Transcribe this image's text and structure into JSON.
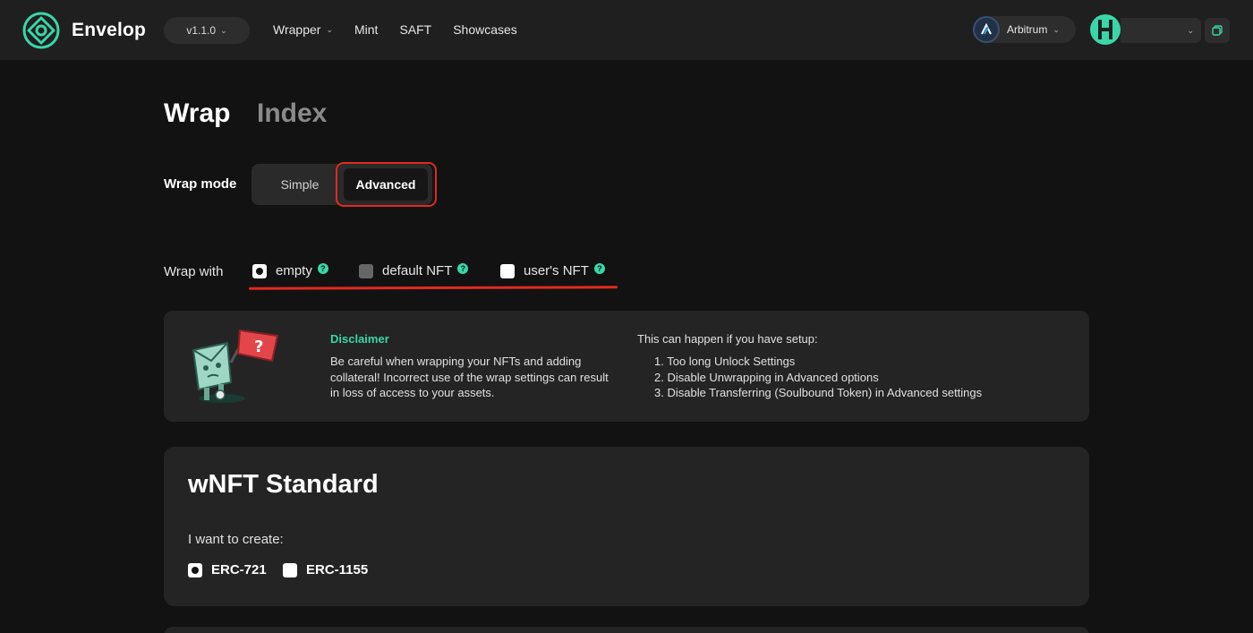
{
  "header": {
    "logo_text": "Envelop",
    "version": "v1.1.0",
    "nav": [
      {
        "label": "Wrapper",
        "dropdown": true
      },
      {
        "label": "Mint",
        "dropdown": false
      },
      {
        "label": "SAFT",
        "dropdown": false
      },
      {
        "label": "Showcases",
        "dropdown": false
      }
    ],
    "network": "Arbitrum",
    "accent_color": "#3ad6a8"
  },
  "tabs": {
    "active": "Wrap",
    "inactive": "Index"
  },
  "wrap_mode": {
    "label": "Wrap mode",
    "options": [
      "Simple",
      "Advanced"
    ],
    "selected": "Advanced"
  },
  "wrap_with": {
    "label": "Wrap with",
    "options": [
      {
        "label": "empty",
        "state": "checked",
        "help": "?"
      },
      {
        "label": "default NFT",
        "state": "disabled",
        "help": "?"
      },
      {
        "label": "user's NFT",
        "state": "unchecked",
        "help": "?"
      }
    ]
  },
  "disclaimer": {
    "title": "Disclaimer",
    "text": "Be careful when wrapping your NFTs and adding collateral! Incorrect use of the wrap settings can result in loss of access to your assets.",
    "right_title": "This can happen if you have setup:",
    "items": [
      "1. Too long Unlock Settings",
      "2. Disable Unwrapping in Advanced options",
      "3. Disable Transferring (Soulbound Token) in Advanced settings"
    ]
  },
  "standard": {
    "title": "wNFT Standard",
    "label": "I want to create:",
    "options": [
      {
        "label": "ERC-721",
        "state": "checked"
      },
      {
        "label": "ERC-1155",
        "state": "unchecked"
      }
    ]
  }
}
